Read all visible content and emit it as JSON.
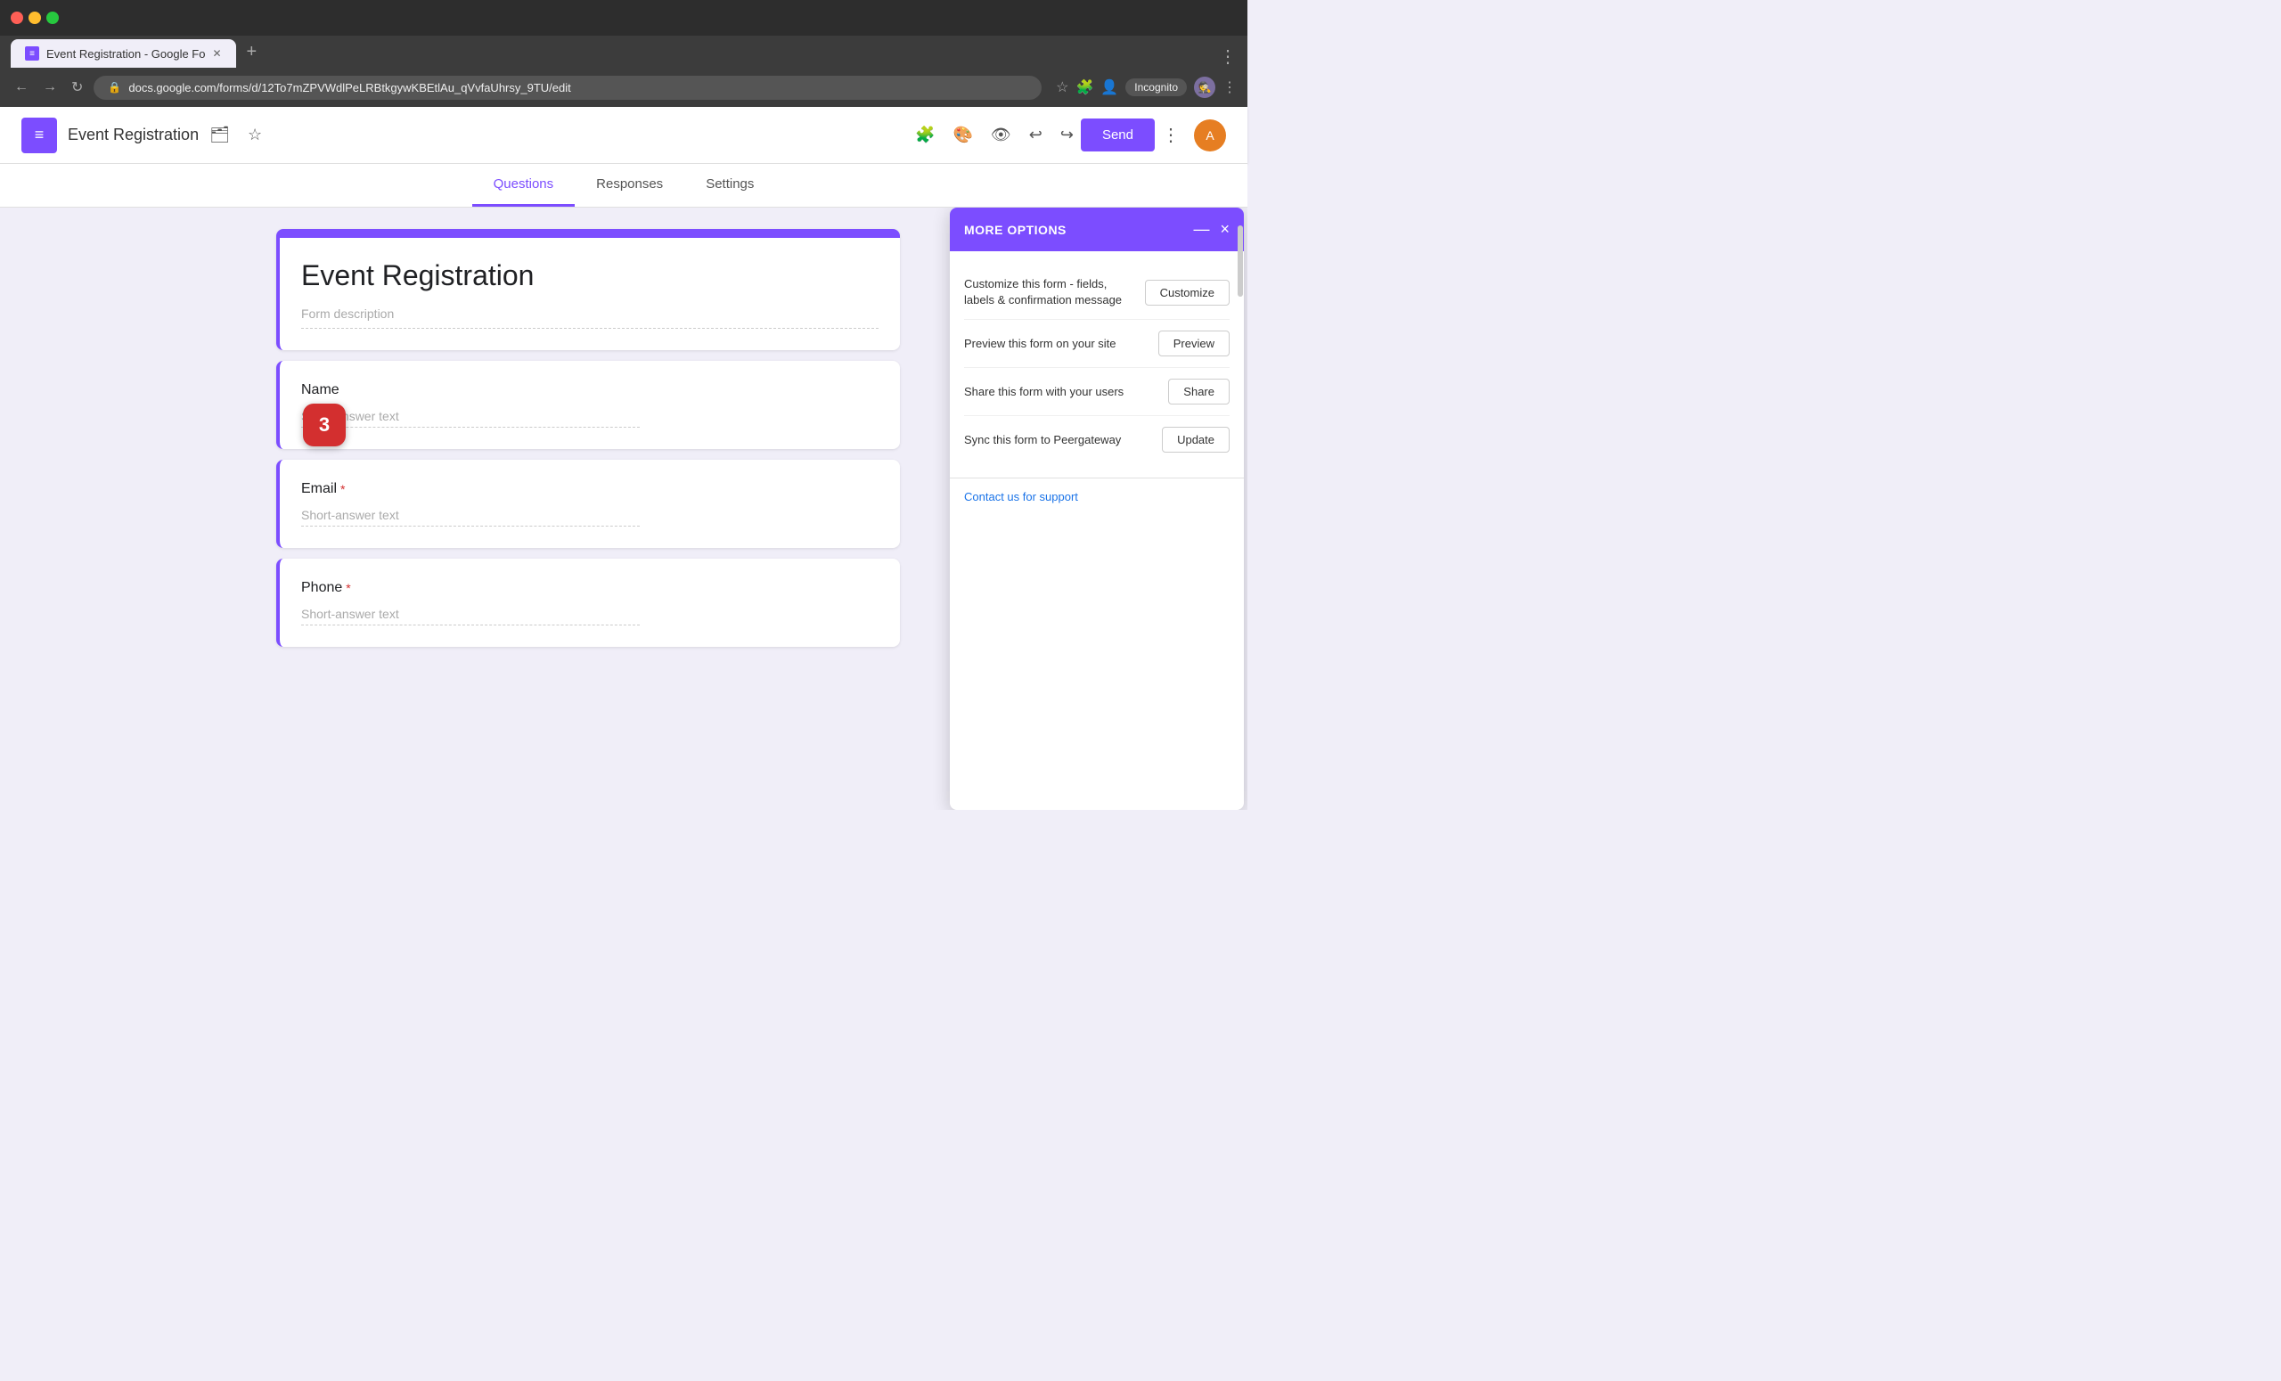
{
  "browser": {
    "tab_title": "Event Registration - Google Fo",
    "tab_favicon": "≡",
    "new_tab_icon": "+",
    "address": "docs.google.com/forms/d/12To7mZPVWdlPeLRBtkgywKBEtlAu_qVvfaUhrsy_9TU/edit",
    "incognito_label": "Incognito",
    "nav": {
      "back": "←",
      "forward": "→",
      "reload": "↻"
    }
  },
  "header": {
    "logo_icon": "≡",
    "title": "Event Registration",
    "send_label": "Send",
    "more_icon": "⋮"
  },
  "tabs": [
    {
      "label": "Questions",
      "active": true
    },
    {
      "label": "Responses",
      "active": false
    },
    {
      "label": "Settings",
      "active": false
    }
  ],
  "form": {
    "title": "Event Registration",
    "description": "Form description",
    "questions": [
      {
        "label": "Name",
        "required": false,
        "answer_placeholder": "Short-answer text"
      },
      {
        "label": "Email",
        "required": true,
        "answer_placeholder": "Short-answer text"
      },
      {
        "label": "Phone",
        "required": true,
        "answer_placeholder": "Short-answer text"
      }
    ]
  },
  "more_options": {
    "title": "MORE OPTIONS",
    "minimize_icon": "—",
    "close_icon": "×",
    "rows": [
      {
        "label": "Customize this form - fields, labels & confirmation message",
        "button_label": "Customize"
      },
      {
        "label": "Preview this form on your site",
        "button_label": "Preview"
      },
      {
        "label": "Share this form with your users",
        "button_label": "Share"
      },
      {
        "label": "Sync this form to Peergateway",
        "button_label": "Update"
      }
    ],
    "footer": {
      "contact_link": "Contact us for support"
    }
  },
  "step_badge": {
    "number": "3"
  },
  "right_panel": {
    "add_icon": "⊕",
    "import_icon": "⬒"
  }
}
